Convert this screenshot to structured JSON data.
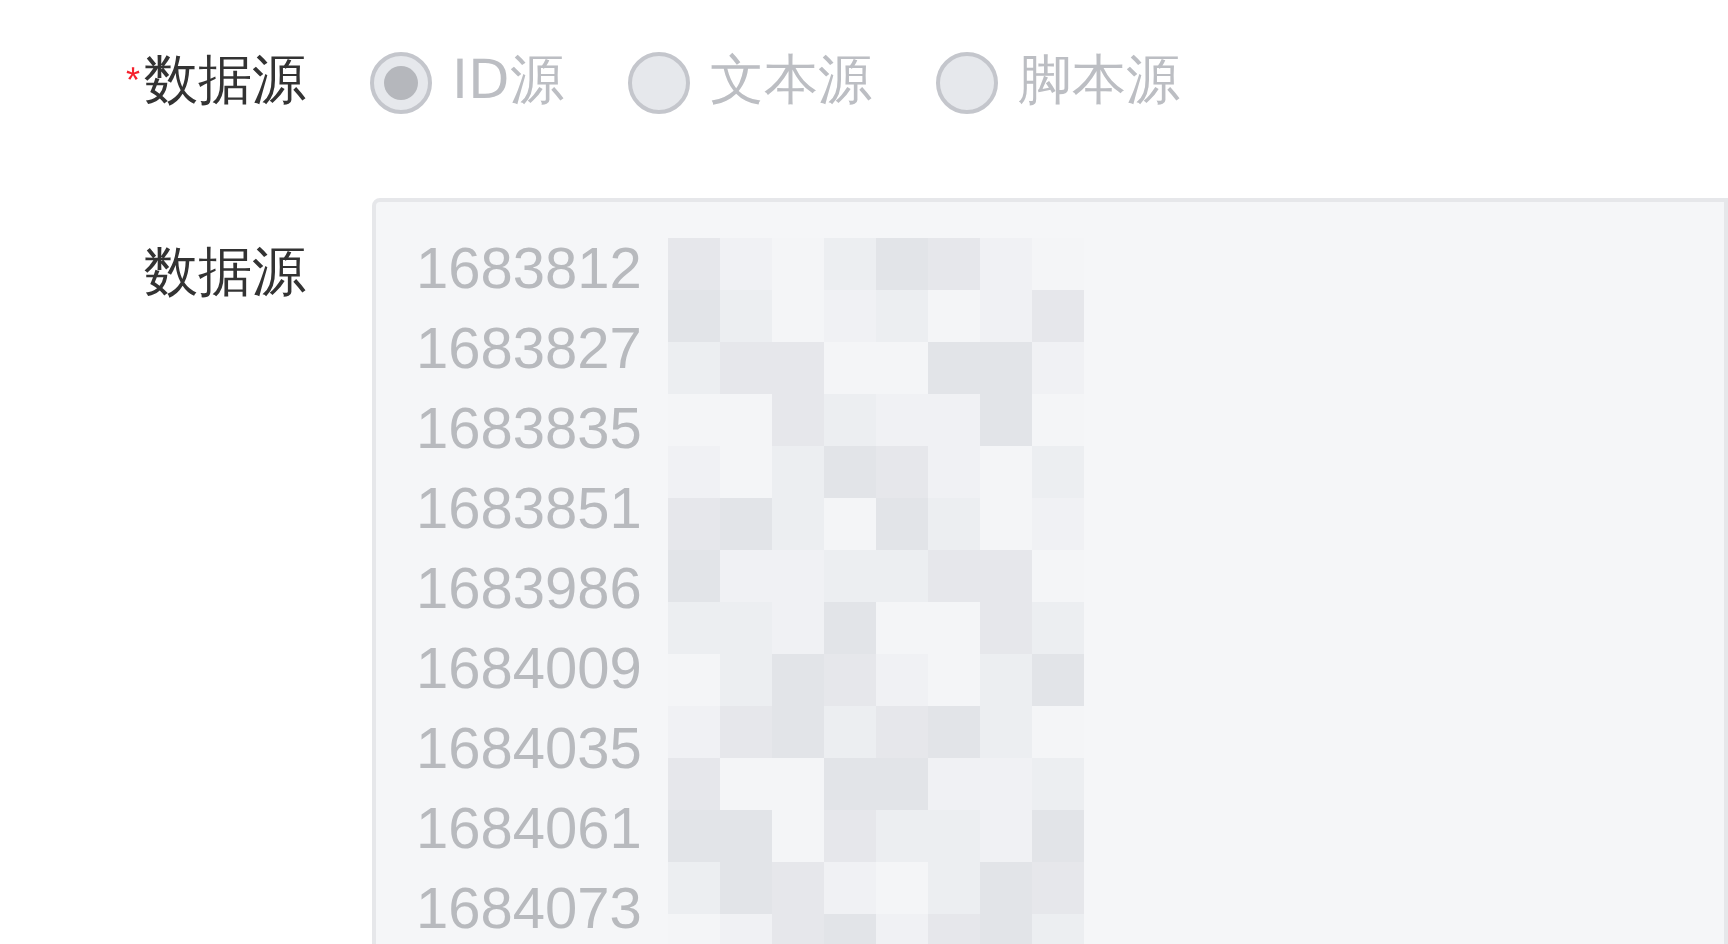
{
  "source_field": {
    "label": "数据源",
    "required_mark": "*",
    "disabled": true,
    "options": [
      {
        "label": "ID源",
        "selected": true
      },
      {
        "label": "文本源",
        "selected": false
      },
      {
        "label": "脚本源",
        "selected": false
      }
    ]
  },
  "data_field": {
    "label": "数据源",
    "lines": [
      "1683812",
      "1683827",
      "1683835",
      "1683851",
      "1683986",
      "1684009",
      "1684035",
      "1684061",
      "1684073"
    ]
  }
}
